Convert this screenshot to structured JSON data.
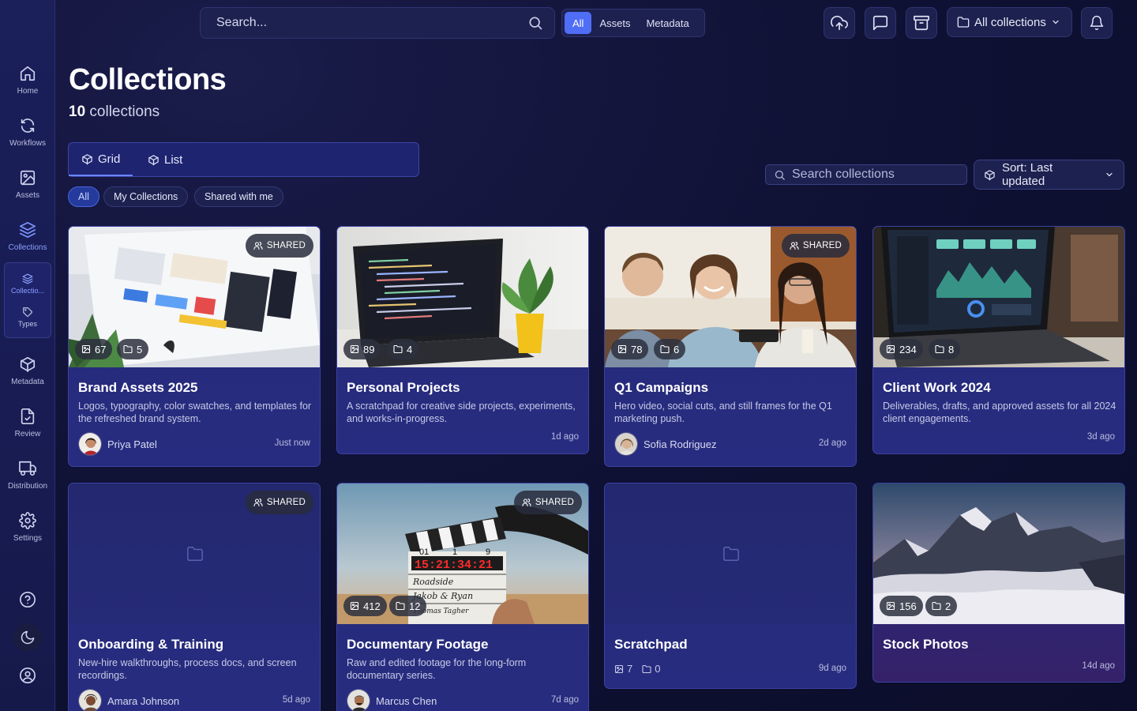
{
  "sidebar": {
    "items": [
      {
        "label": "Home",
        "icon": "home-icon"
      },
      {
        "label": "Workflows",
        "icon": "refresh-icon"
      },
      {
        "label": "Assets",
        "icon": "image-icon"
      },
      {
        "label": "Collections",
        "icon": "layers-icon"
      },
      {
        "label": "Metadata",
        "icon": "cube-icon"
      },
      {
        "label": "Review",
        "icon": "file-check-icon"
      },
      {
        "label": "Distribution",
        "icon": "truck-icon"
      },
      {
        "label": "Settings",
        "icon": "gear-icon"
      }
    ],
    "sub_items": [
      {
        "label": "Collectio...",
        "icon": "layers-icon"
      },
      {
        "label": "Types",
        "icon": "tag-icon"
      }
    ]
  },
  "topbar": {
    "search_placeholder": "Search...",
    "scopes": [
      "All",
      "Assets",
      "Metadata"
    ],
    "active_scope": "All",
    "collections_dropdown": "All collections"
  },
  "page": {
    "title": "Collections",
    "count_number": "10",
    "count_label": "collections"
  },
  "view": {
    "tabs": [
      "Grid",
      "List"
    ],
    "active": "Grid",
    "filters": [
      "All",
      "My Collections",
      "Shared with me"
    ],
    "active_filter": "All",
    "search_placeholder": "Search collections",
    "sort_label": "Sort: Last updated"
  },
  "cards": [
    {
      "title": "Brand Assets 2025",
      "desc": "Logos, typography, color swatches, and templates for the refreshed brand system.",
      "assets": "67",
      "folders": "5",
      "shared": "SHARED",
      "owner": "Priya Patel",
      "time": "Just now"
    },
    {
      "title": "Personal Projects",
      "desc": "A scratchpad for creative side projects, experiments, and works-in-progress.",
      "assets": "89",
      "folders": "4",
      "time": "1d ago"
    },
    {
      "title": "Q1 Campaigns",
      "desc": "Hero video, social cuts, and still frames for the Q1 marketing push.",
      "assets": "78",
      "folders": "6",
      "shared": "SHARED",
      "owner": "Sofia Rodriguez",
      "time": "2d ago"
    },
    {
      "title": "Client Work 2024",
      "desc": "Deliverables, drafts, and approved assets for all 2024 client engagements.",
      "assets": "234",
      "folders": "8",
      "time": "3d ago"
    },
    {
      "title": "Onboarding & Training",
      "desc": "New-hire walkthroughs, process docs, and screen recordings.",
      "shared": "SHARED",
      "owner": "Amara Johnson",
      "time": "5d ago"
    },
    {
      "title": "Documentary Footage",
      "desc": "Raw and edited footage for the long-form documentary series.",
      "assets": "412",
      "folders": "12",
      "shared": "SHARED",
      "owner": "Marcus Chen",
      "time": "7d ago"
    },
    {
      "title": "Scratchpad",
      "assets": "7",
      "folders": "0",
      "time": "9d ago"
    },
    {
      "title": "Stock Photos",
      "assets": "156",
      "folders": "2",
      "time": "14d ago"
    }
  ],
  "clapper": {
    "timecode": "15:21:34:21",
    "roll": "01",
    "scene": "1",
    "take": "9",
    "production": "Roadside",
    "director": "Jakob & Ryan",
    "camera": "Thomas Tagher"
  },
  "colors": {
    "accent": "#4f6df5",
    "sidebar": "#1b1f5a",
    "card": "#262b7a",
    "background": "#101236"
  }
}
